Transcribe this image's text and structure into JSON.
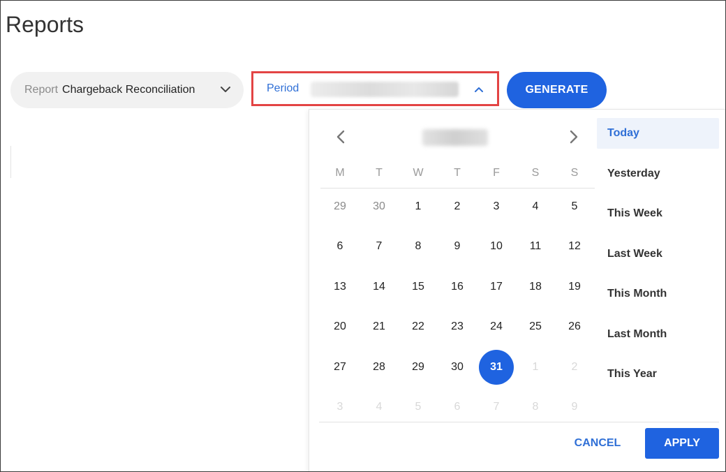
{
  "page": {
    "title": "Reports"
  },
  "report_select": {
    "label": "Report",
    "value": "Chargeback Reconciliation"
  },
  "period": {
    "label": "Period",
    "value_blurred": true
  },
  "generate": {
    "label": "GENERATE"
  },
  "calendar": {
    "month_label_blurred": true,
    "weekdays": [
      "M",
      "T",
      "W",
      "T",
      "F",
      "S",
      "S"
    ],
    "weeks": [
      [
        {
          "d": "29",
          "s": "muted"
        },
        {
          "d": "30",
          "s": "muted"
        },
        {
          "d": "1",
          "s": "normal"
        },
        {
          "d": "2",
          "s": "normal"
        },
        {
          "d": "3",
          "s": "normal"
        },
        {
          "d": "4",
          "s": "normal"
        },
        {
          "d": "5",
          "s": "normal"
        }
      ],
      [
        {
          "d": "6",
          "s": "normal"
        },
        {
          "d": "7",
          "s": "normal"
        },
        {
          "d": "8",
          "s": "normal"
        },
        {
          "d": "9",
          "s": "normal"
        },
        {
          "d": "10",
          "s": "normal"
        },
        {
          "d": "11",
          "s": "normal"
        },
        {
          "d": "12",
          "s": "normal"
        }
      ],
      [
        {
          "d": "13",
          "s": "normal"
        },
        {
          "d": "14",
          "s": "normal"
        },
        {
          "d": "15",
          "s": "normal"
        },
        {
          "d": "16",
          "s": "normal"
        },
        {
          "d": "17",
          "s": "normal"
        },
        {
          "d": "18",
          "s": "normal"
        },
        {
          "d": "19",
          "s": "normal"
        }
      ],
      [
        {
          "d": "20",
          "s": "normal"
        },
        {
          "d": "21",
          "s": "normal"
        },
        {
          "d": "22",
          "s": "normal"
        },
        {
          "d": "23",
          "s": "normal"
        },
        {
          "d": "24",
          "s": "normal"
        },
        {
          "d": "25",
          "s": "normal"
        },
        {
          "d": "26",
          "s": "normal"
        }
      ],
      [
        {
          "d": "27",
          "s": "normal"
        },
        {
          "d": "28",
          "s": "normal"
        },
        {
          "d": "29",
          "s": "normal"
        },
        {
          "d": "30",
          "s": "normal"
        },
        {
          "d": "31",
          "s": "selected"
        },
        {
          "d": "1",
          "s": "faded"
        },
        {
          "d": "2",
          "s": "faded"
        }
      ],
      [
        {
          "d": "3",
          "s": "faded"
        },
        {
          "d": "4",
          "s": "faded"
        },
        {
          "d": "5",
          "s": "faded"
        },
        {
          "d": "6",
          "s": "faded"
        },
        {
          "d": "7",
          "s": "faded"
        },
        {
          "d": "8",
          "s": "faded"
        },
        {
          "d": "9",
          "s": "faded"
        }
      ]
    ]
  },
  "presets": [
    {
      "label": "Today",
      "active": true
    },
    {
      "label": "Yesterday",
      "active": false
    },
    {
      "label": "This Week",
      "active": false
    },
    {
      "label": "Last Week",
      "active": false
    },
    {
      "label": "This Month",
      "active": false
    },
    {
      "label": "Last Month",
      "active": false
    },
    {
      "label": "This Year",
      "active": false
    }
  ],
  "footer": {
    "cancel": "CANCEL",
    "apply": "APPLY"
  },
  "colors": {
    "primary": "#1f63e0",
    "link": "#2f6fd6",
    "highlight_border": "#e34444",
    "preset_active_bg": "#eef3fb"
  },
  "icons": {
    "report_chevron": "chevron-down-icon",
    "period_chevron": "chevron-up-icon",
    "prev": "chevron-left-icon",
    "next": "chevron-right-icon"
  }
}
